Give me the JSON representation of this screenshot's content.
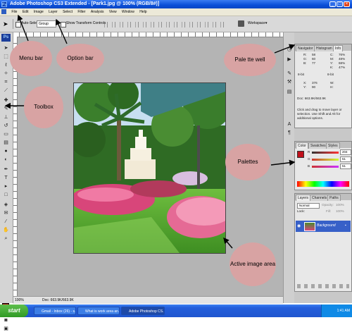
{
  "window": {
    "title": "Adobe Photoshop CS3 Extended - [Park1.jpg @ 100% (RGB/8#)]",
    "app_icon": "Ps"
  },
  "menubar": {
    "items": [
      "File",
      "Edit",
      "Image",
      "Layer",
      "Select",
      "Filter",
      "Analysis",
      "View",
      "Window",
      "Help"
    ]
  },
  "optionsbar": {
    "auto_select_label": "Auto-Select:",
    "auto_select_value": "Group",
    "show_transform_label": "Show Transform Controls",
    "workspace_label": "Workspace"
  },
  "toolbox": {
    "logo": "Ps"
  },
  "status": {
    "zoom": "100%",
    "doc": "Doc: 663.9K/663.9K"
  },
  "panels": {
    "top": {
      "tabs": [
        "Navigator",
        "Histogram",
        "Info"
      ],
      "info": {
        "r_label": "R:",
        "r_val": "58",
        "g_label": "G:",
        "g_val": "60",
        "b_label": "B:",
        "b_val": "77",
        "c_label": "C:",
        "c_val": "76%",
        "m_label": "M:",
        "m_val": "48%",
        "y_label": "Y:",
        "y_val": "68%",
        "k_label": "K:",
        "k_val": "47%",
        "bit_a": "8-bit",
        "bit_b": "8-bit",
        "x_label": "X:",
        "x_val": "376",
        "y2_label": "Y:",
        "y2_val": "90",
        "w_label": "W:",
        "h_label": "H:",
        "doc": "Doc: 663.9K/663.9K",
        "hint": "Click and drag to move layer or selection. Use Shift and Alt for additional options."
      }
    },
    "middle": {
      "tabs": [
        "Color",
        "Swatches",
        "Styles"
      ],
      "r_label": "R",
      "r_val": "204",
      "g_label": "G",
      "g_val": "51",
      "b_label": "B",
      "b_val": "51"
    },
    "bottom": {
      "tabs": [
        "Layers",
        "Channels",
        "Paths"
      ],
      "blend_mode": "Normal",
      "opacity_label": "Opacity:",
      "opacity_val": "100%",
      "lock_label": "Lock:",
      "fill_label": "Fill:",
      "fill_val": "100%",
      "layer_name": "Background"
    }
  },
  "taskbar": {
    "start": "start",
    "items": [
      "Gmail - Inbox (26) - s...",
      "What is work area an...",
      "Adobe Photoshop CS..."
    ],
    "clock": "1:41 AM"
  },
  "callouts": {
    "menu_bar": "Menu bar",
    "option_bar": "Option bar",
    "palette_well": "Pale tte well",
    "toolbox": "Toolbox",
    "palettes": "Palettes",
    "active_image_area": "Active image area"
  },
  "colors": {
    "callout": "#d8a3a3",
    "xp_blue": "#0a4fd7",
    "fg_swatch": "#c0101a"
  }
}
